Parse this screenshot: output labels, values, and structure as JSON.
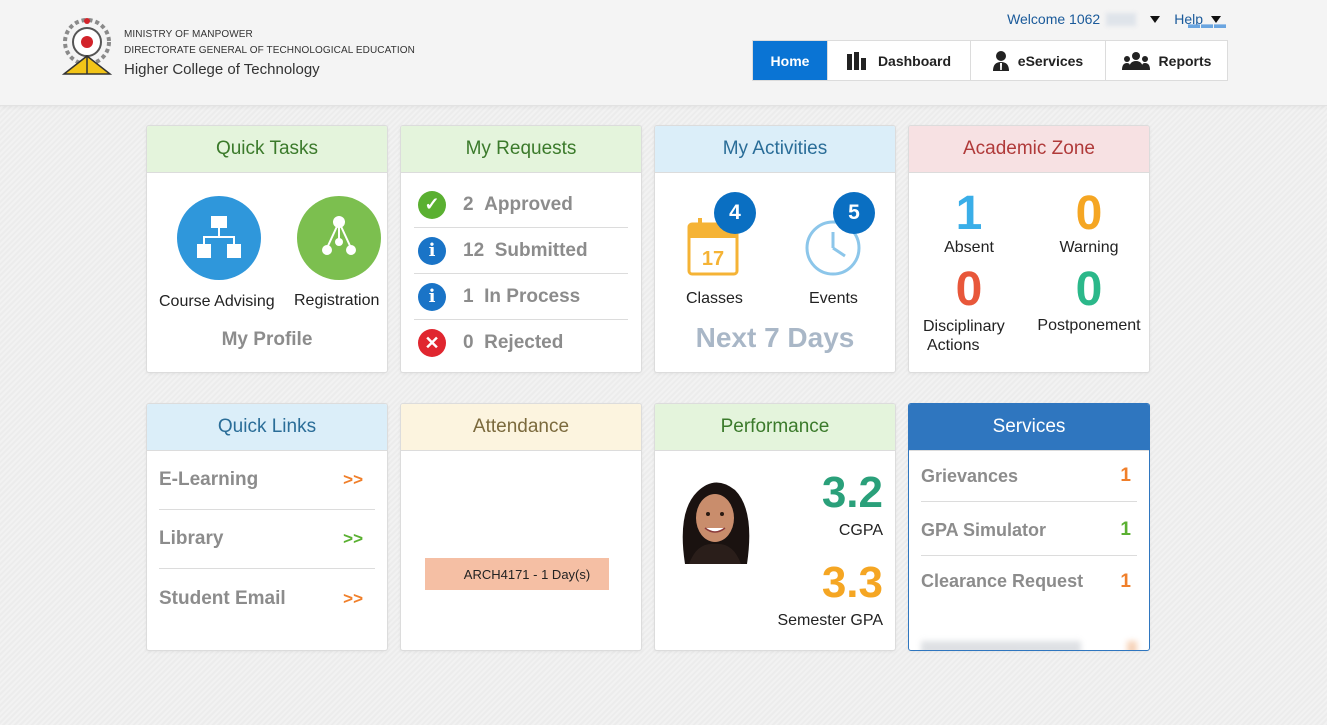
{
  "header": {
    "org_line1": "MINISTRY OF MANPOWER",
    "org_line2": "DIRECTORATE GENERAL OF TECHNOLOGICAL EDUCATION",
    "org_line3": "Higher College of Technology",
    "welcome": "Welcome 1062",
    "help": "Help"
  },
  "nav": {
    "home": "Home",
    "dashboard": "Dashboard",
    "eservices": "eServices",
    "reports": "Reports"
  },
  "quick_tasks": {
    "title": "Quick Tasks",
    "course_advising": "Course Advising",
    "registration": "Registration",
    "my_profile": "My Profile"
  },
  "my_requests": {
    "title": "My Requests",
    "items": [
      {
        "count": "2",
        "label": "Approved",
        "color": "#5ab031"
      },
      {
        "count": "12",
        "label": "Submitted",
        "color": "#1a74c7"
      },
      {
        "count": "1",
        "label": "In Process",
        "color": "#1a74c7"
      },
      {
        "count": "0",
        "label": "Rejected",
        "color": "#e0262f"
      }
    ]
  },
  "my_activities": {
    "title": "My Activities",
    "classes_count": "4",
    "classes_label": "Classes",
    "calendar_day": "17",
    "events_count": "5",
    "events_label": "Events",
    "next_days": "Next 7 Days"
  },
  "academic_zone": {
    "title": "Academic Zone",
    "absent_value": "1",
    "absent_label": "Absent",
    "warning_value": "0",
    "warning_label": "Warning",
    "disciplinary_value": "0",
    "disciplinary_label_1": "Disciplinary",
    "disciplinary_label_2": "Actions",
    "postponement_value": "0",
    "postponement_label": "Postponement"
  },
  "quick_links": {
    "title": "Quick Links",
    "items": [
      {
        "label": "E-Learning",
        "arrow": ">>",
        "color": "#f07f2a"
      },
      {
        "label": "Library",
        "arrow": ">>",
        "color": "#5ab031"
      },
      {
        "label": "Student Email",
        "arrow": ">>",
        "color": "#f07f2a"
      }
    ]
  },
  "attendance": {
    "title": "Attendance",
    "entry": "ARCH4171 - 1 Day(s)"
  },
  "performance": {
    "title": "Performance",
    "cgpa_value": "3.2",
    "cgpa_label": "CGPA",
    "sem_gpa_value": "3.3",
    "sem_gpa_label": "Semester GPA"
  },
  "services": {
    "title": "Services",
    "items": [
      {
        "label": "Grievances",
        "count": "1",
        "color": "#f07f2a"
      },
      {
        "label": "GPA Simulator",
        "count": "1",
        "color": "#5ab031"
      },
      {
        "label": "Clearance Request",
        "count": "1",
        "color": "#f07f2a"
      }
    ]
  },
  "colors": {
    "primary": "#0a74d4",
    "absent": "#3aaee8",
    "warning": "#f5a623",
    "disciplinary": "#e8573a",
    "postponement": "#2bb88a",
    "cgpa": "#2aa07a",
    "sem_gpa": "#f5a623"
  }
}
